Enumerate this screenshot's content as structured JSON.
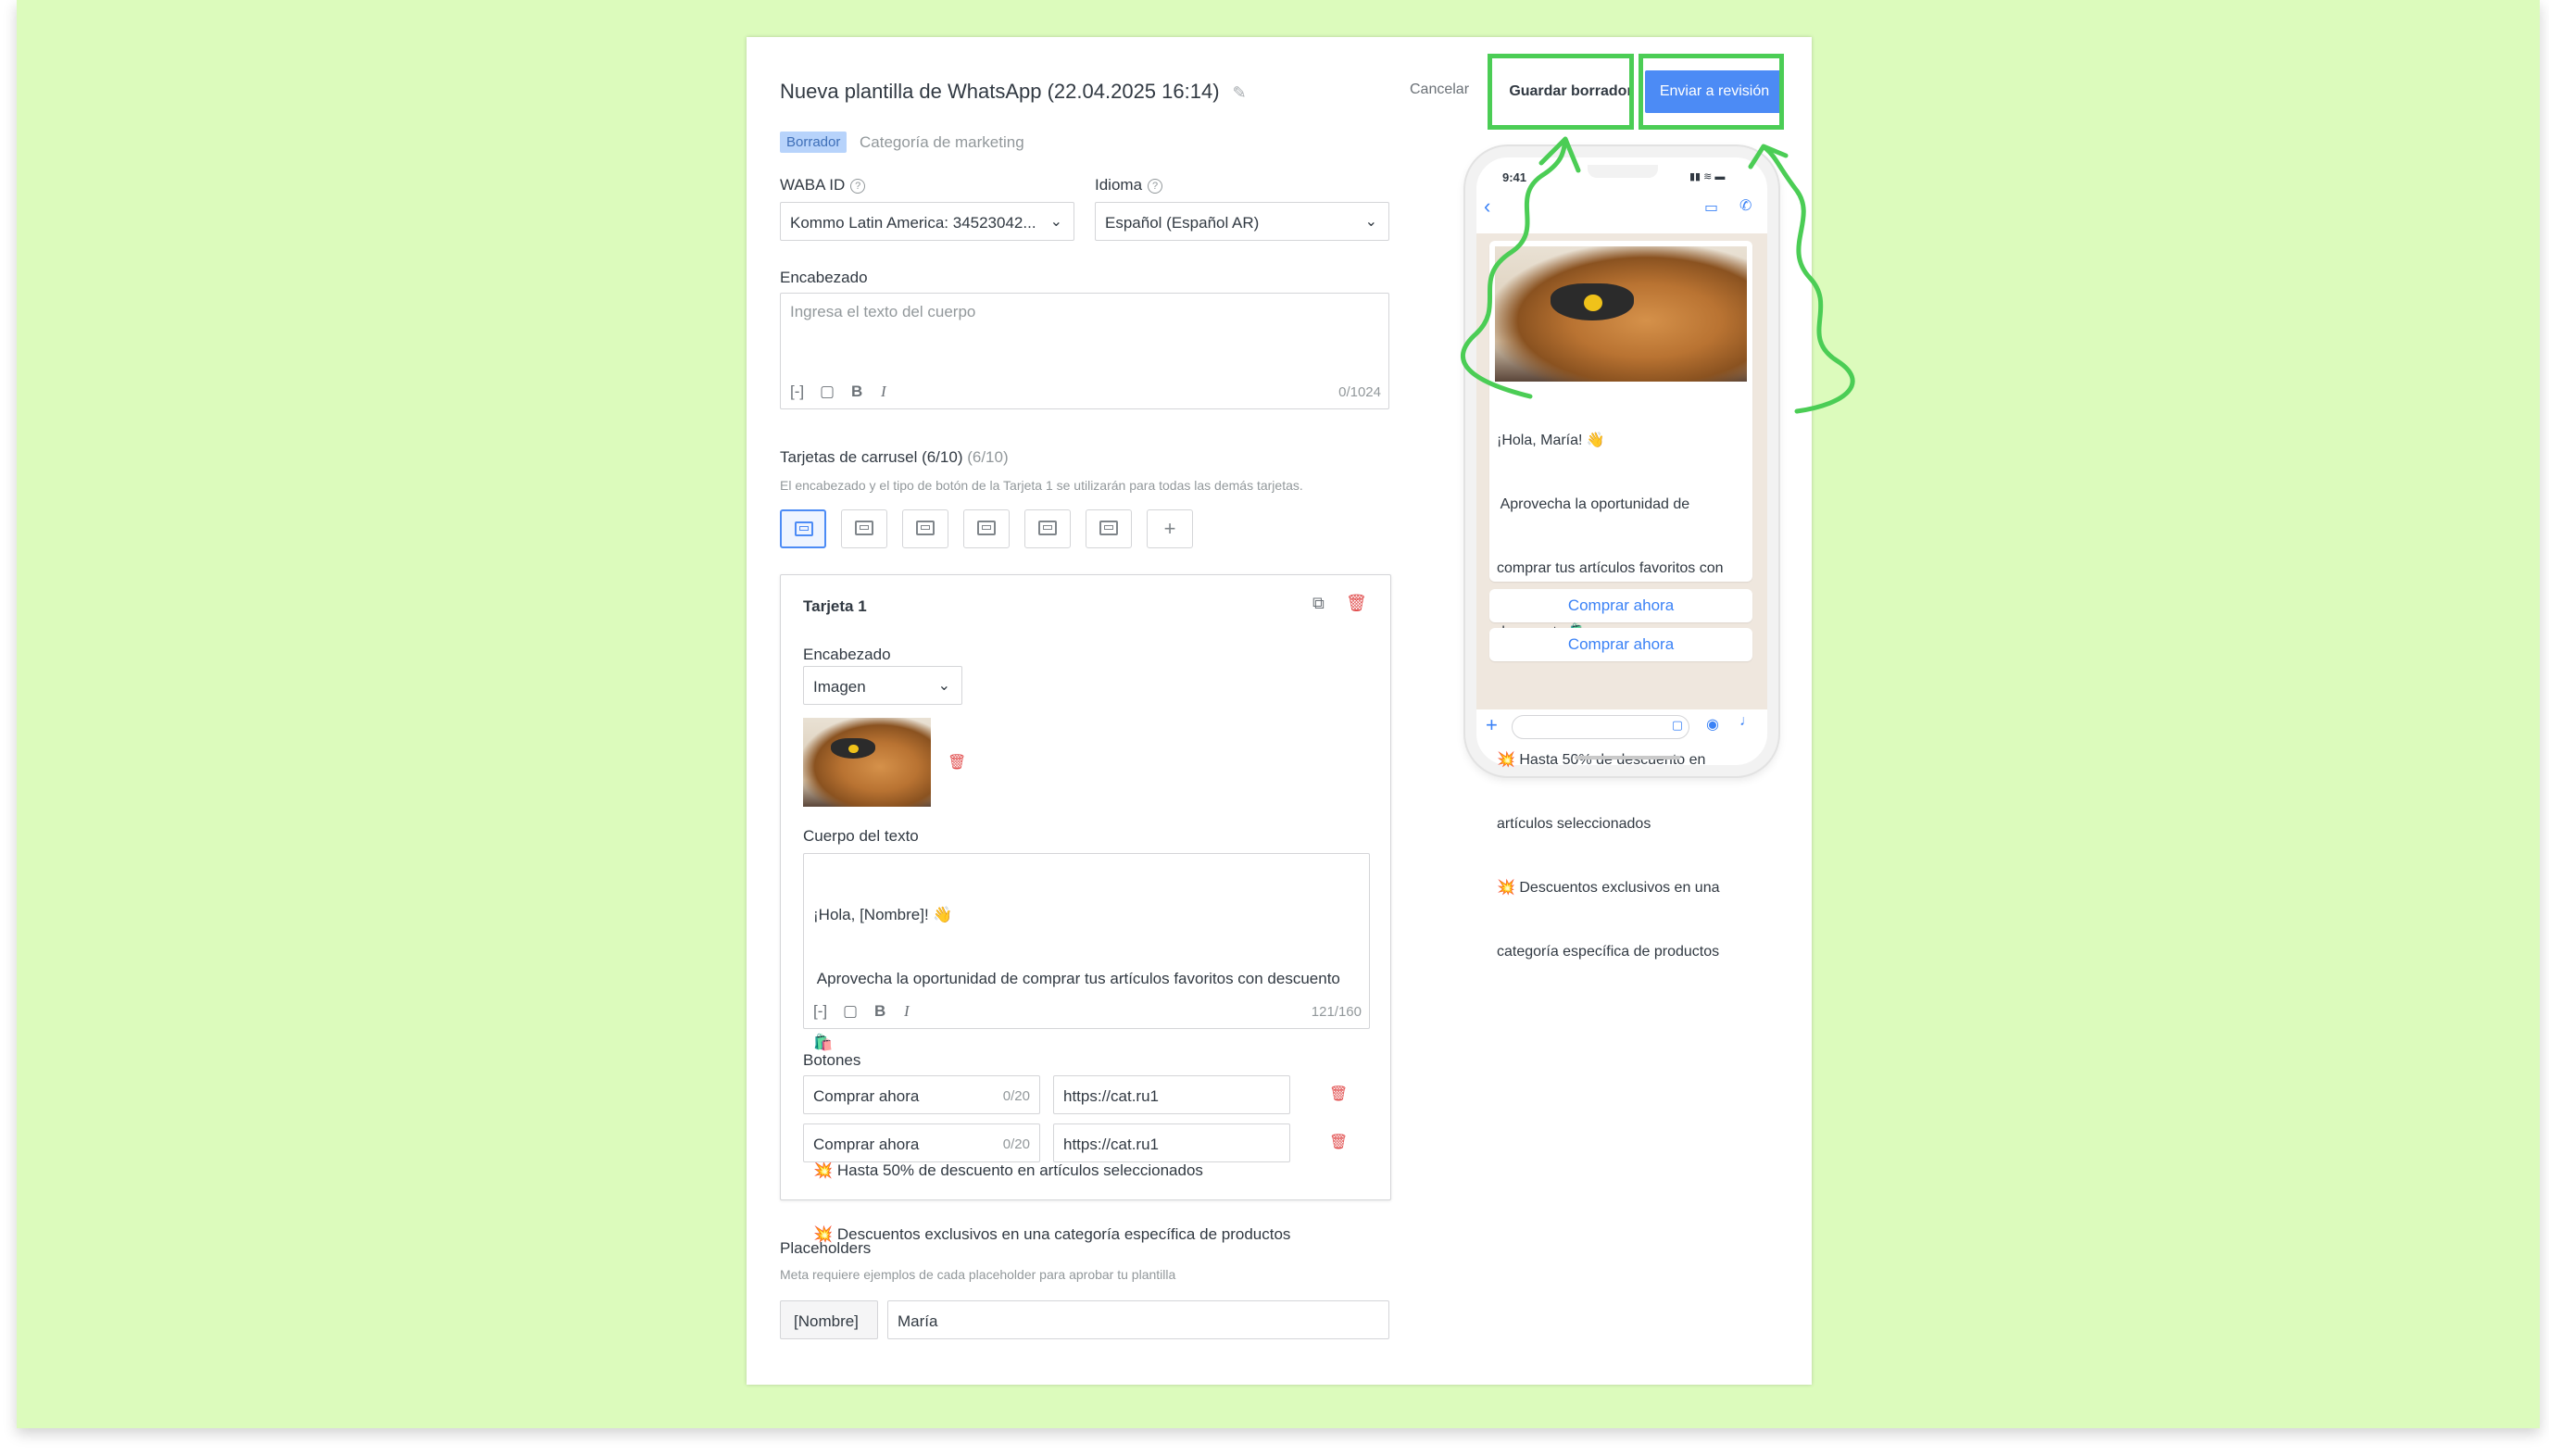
{
  "header": {
    "title": "Nueva plantilla de WhatsApp (22.04.2025 16:14)",
    "cancel_label": "Cancelar",
    "save_draft_label": "Guardar borrador",
    "submit_label": "Enviar a revisión"
  },
  "status": {
    "badge": "Borrador",
    "category": "Categoría de marketing"
  },
  "waba": {
    "label": "WABA ID",
    "value": "Kommo Latin America: 34523042..."
  },
  "language": {
    "label": "Idioma",
    "value": "Español (Español AR)"
  },
  "header_section": {
    "label": "Encabezado",
    "placeholder": "Ingresa el texto del cuerpo",
    "counter": "0/1024",
    "bold": "B",
    "italic": "I",
    "var": "[-]"
  },
  "carousel": {
    "title": "Tarjetas de carrusel (6/10)",
    "title_count": "(6/10)",
    "note": "El encabezado y el tipo de botón de la Tarjeta 1 se utilizarán para todas las demás tarjetas.",
    "add_label": "+"
  },
  "card1": {
    "title": "Tarjeta 1",
    "header_label": "Encabezado",
    "header_type": "Imagen",
    "body_label": "Cuerpo del texto",
    "body_lines": [
      "¡Hola, [Nombre]! 👋",
      " Aprovecha la oportunidad de comprar tus artículos favoritos con descuento",
      "🛍️",
      "",
      "💥 Hasta 50% de descuento en artículos seleccionados",
      "💥 Descuentos exclusivos en una categoría específica de productos"
    ],
    "body_counter": "121/160",
    "buttons_label": "Botones",
    "buttons": [
      {
        "text": "Comprar ahora",
        "counter": "0/20",
        "url": "https://cat.ru1"
      },
      {
        "text": "Comprar ahora",
        "counter": "0/20",
        "url": "https://cat.ru1"
      }
    ]
  },
  "placeholders": {
    "title": "Placeholders",
    "note": "Meta requiere ejemplos de cada placeholder para aprobar tu plantilla",
    "key": "[Nombre]",
    "value": "María"
  },
  "preview": {
    "time": "9:41",
    "lines": [
      "¡Hola, María! 👋",
      " Aprovecha la oportunidad de",
      "comprar tus artículos favoritos con",
      "descuento 🛍️",
      "",
      "💥 Hasta 50% de descuento en",
      "artículos seleccionados",
      "💥 Descuentos exclusivos en una",
      "categoría específica de productos"
    ],
    "button1": "Comprar ahora",
    "button2": "Comprar ahora"
  },
  "colors": {
    "background": "#dcfbbc",
    "accent": "#4c8bf5",
    "highlight": "#4bcd55",
    "danger": "#e14d4d"
  }
}
